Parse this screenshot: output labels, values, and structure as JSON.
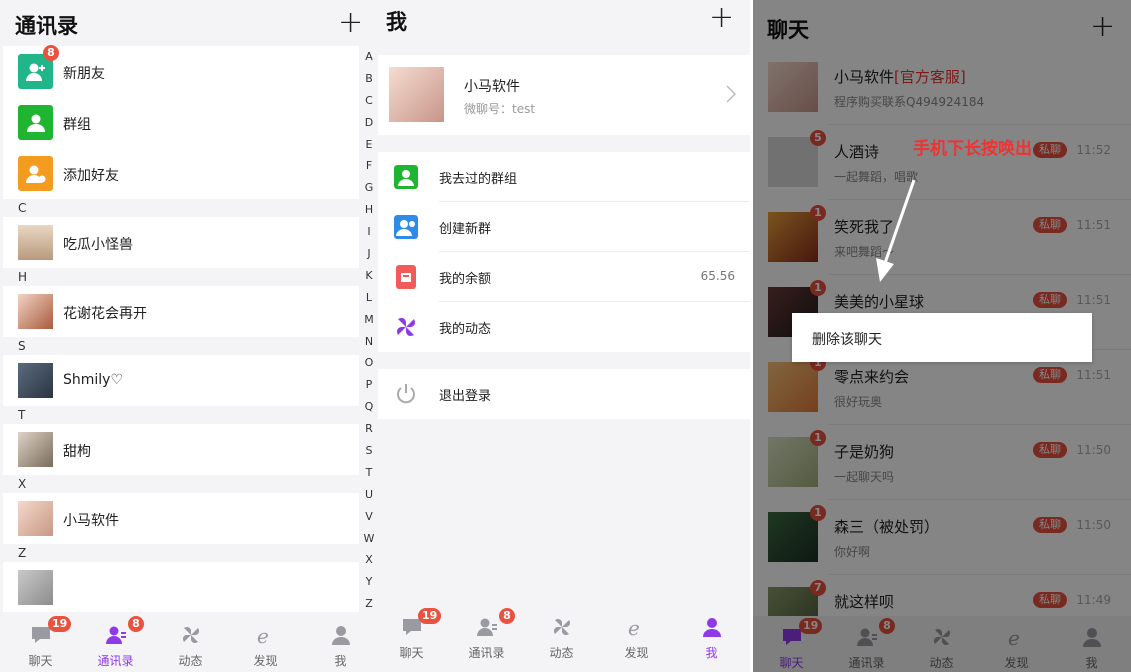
{
  "contacts": {
    "title": "通讯录",
    "plus": "+",
    "fixed": [
      {
        "name": "新朋友",
        "badge": "8",
        "color": "#21b58a"
      },
      {
        "name": "群组",
        "color": "#1fb531"
      },
      {
        "name": "添加好友",
        "color": "#f39c1f"
      }
    ],
    "sections": [
      {
        "letter": "C",
        "name": "吃瓜小怪兽"
      },
      {
        "letter": "H",
        "name": "花谢花会再开"
      },
      {
        "letter": "S",
        "name": "Shmily♡"
      },
      {
        "letter": "T",
        "name": "甜枸"
      },
      {
        "letter": "X",
        "name": "小马软件"
      },
      {
        "letter": "Z",
        "name": ""
      }
    ],
    "alphabet": [
      "A",
      "B",
      "C",
      "D",
      "E",
      "F",
      "G",
      "H",
      "I",
      "J",
      "K",
      "L",
      "M",
      "N",
      "O",
      "P",
      "Q",
      "R",
      "S",
      "T",
      "U",
      "V",
      "W",
      "X",
      "Y",
      "Z"
    ]
  },
  "tabs": [
    {
      "label": "聊天",
      "badge": "19",
      "icon": "chat-icon"
    },
    {
      "label": "通讯录",
      "badge": "8",
      "icon": "contacts-icon"
    },
    {
      "label": "动态",
      "icon": "moments-icon"
    },
    {
      "label": "发现",
      "icon": "discover-icon"
    },
    {
      "label": "我",
      "icon": "me-icon"
    }
  ],
  "me": {
    "title": "我",
    "plus": "+",
    "name": "小马软件",
    "account": "微聊号：test",
    "items": [
      {
        "label": "我去过的群组",
        "color": "#1fb531",
        "value": ""
      },
      {
        "label": "创建新群",
        "color": "#2f8be6",
        "value": ""
      },
      {
        "label": "我的余额",
        "color": "#f35a5a",
        "value": "65.56"
      },
      {
        "label": "我的动态",
        "color": "#8e3ae8",
        "value": ""
      }
    ],
    "logout": "退出登录"
  },
  "chat": {
    "title": "聊天",
    "plus": "+",
    "rows": [
      {
        "name": "小马软件",
        "official": "[官方客服]",
        "sub": "程序购买联系Q494924184",
        "time": "",
        "tag": "",
        "badge": ""
      },
      {
        "name": "人酒诗",
        "sub": "一起舞蹈，唱歌",
        "time": "11:52",
        "tag": "私聊",
        "badge": "5"
      },
      {
        "name": "笑死我了",
        "sub": "来吧舞蹈～",
        "time": "11:51",
        "tag": "私聊",
        "badge": "1"
      },
      {
        "name": "美美的小星球",
        "sub": "",
        "time": "11:51",
        "tag": "私聊",
        "badge": "1"
      },
      {
        "name": "零点来约会",
        "sub": "很好玩奥",
        "time": "11:51",
        "tag": "私聊",
        "badge": "1"
      },
      {
        "name": "子是奶狗",
        "sub": "一起聊天吗",
        "time": "11:50",
        "tag": "私聊",
        "badge": "1"
      },
      {
        "name": "森三（被处罚）",
        "sub": "你好啊",
        "time": "11:50",
        "tag": "私聊",
        "badge": "1"
      },
      {
        "name": "就这样呗",
        "sub": "",
        "time": "11:49",
        "tag": "私聊",
        "badge": "7"
      }
    ],
    "context_menu": "删除该聊天",
    "annotation": "手机下长按唤出"
  },
  "colors": {
    "accent": "#8e3ae8",
    "badge": "#e8523f"
  }
}
